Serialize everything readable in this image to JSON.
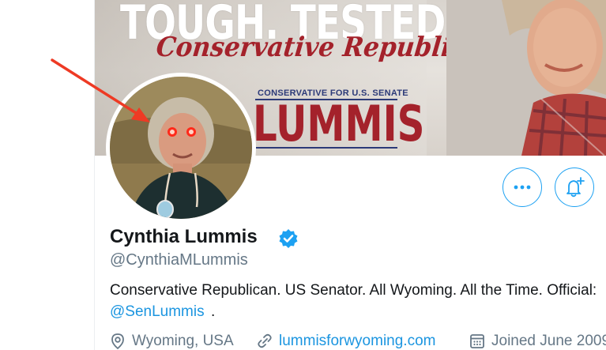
{
  "banner": {
    "headline": "TOUGH. TESTED. TRUE",
    "tagline": "Conservative Republican",
    "subline": "CONSERVATIVE FOR U.S. SENATE",
    "name": "LUMMIS"
  },
  "profile": {
    "display_name": "Cynthia Lummis",
    "handle": "@CynthiaMLummis",
    "bio": "Conservative Republican. US Senator. All Wyoming. All the Time. Official:",
    "bio_link": "@SenLummis",
    "bio_end": ".",
    "location": "Wyoming, USA",
    "url": "lummisforwyoming.com",
    "joined": "Joined June 2009"
  },
  "icons": {
    "more": "more-horizontal-icon",
    "notifications": "bell-plus-icon",
    "verified": "verified-badge-icon",
    "location": "location-pin-icon",
    "link": "link-icon",
    "calendar": "calendar-icon"
  },
  "colors": {
    "accent": "#1da1f2",
    "link": "#1b95e0",
    "secondary_text": "#657786",
    "annotation_arrow": "#ee3a24",
    "banner_red": "#a4222b",
    "banner_navy": "#2c3a78"
  }
}
